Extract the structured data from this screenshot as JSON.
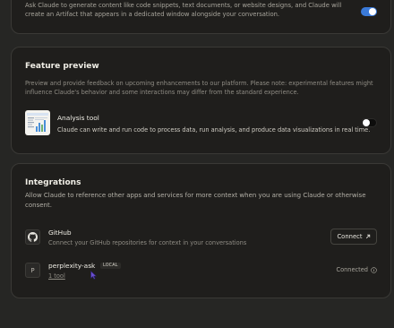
{
  "artifacts": {
    "description": "Ask Claude to generate content like code snippets, text documents, or website designs, and Claude will create an Artifact that appears in a dedicated window alongside your conversation.",
    "enabled": true
  },
  "feature_preview": {
    "title": "Feature preview",
    "description": "Preview and provide feedback on upcoming enhancements to our platform. Please note: experimental features might influence Claude's behavior and some interactions may differ from the standard experience.",
    "analysis_tool": {
      "title": "Analysis tool",
      "description": "Claude can write and run code to process data, run analysis, and produce data visualizations in real time.",
      "enabled": false
    }
  },
  "integrations": {
    "title": "Integrations",
    "description": "Allow Claude to reference other apps and services for more context when you are using Claude or otherwise consent.",
    "items": [
      {
        "name": "GitHub",
        "description": "Connect your GitHub repositories for context in your conversations",
        "action_label": "Connect",
        "icon": "github-icon"
      },
      {
        "name": "perplexity-ask",
        "badge": "LOCAL",
        "icon_letter": "P",
        "tools_link": "1 tool",
        "status": "Connected"
      }
    ]
  },
  "colors": {
    "background": "#262624",
    "card": "#1f1e1c",
    "toggle_on": "#3a7ad9"
  }
}
